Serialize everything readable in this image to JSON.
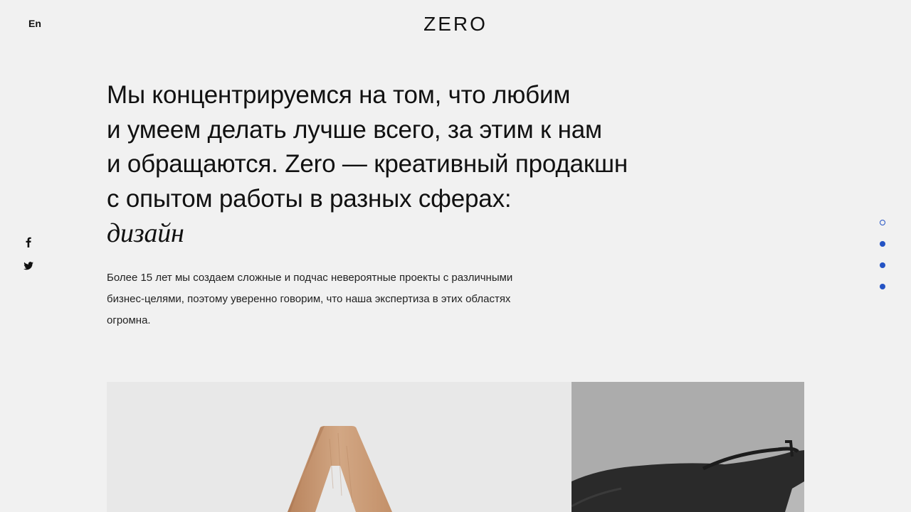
{
  "header": {
    "lang_switch": "En",
    "logo": "ZERO"
  },
  "social": {
    "items": [
      {
        "icon": "facebook-icon"
      },
      {
        "icon": "twitter-icon"
      }
    ]
  },
  "hero": {
    "lines": [
      "Мы концентрируемся на том, что любим",
      "и умеем делать лучше всего, за этим к нам",
      "и обращаются. Zero — креативный продакшн",
      "с опытом работы в разных сферах:"
    ],
    "accent_word": "дизайн"
  },
  "intro": {
    "text": "Более 15 лет мы создаем сложные и подчас невероятные проекты с различными бизнес-целями, поэтому уверенно говорим, что наша экспертиза в этих областях огромна."
  },
  "slide_nav": {
    "count": 4,
    "active_index": 0
  },
  "colors": {
    "background": "#f1f1f1",
    "text": "#111111",
    "accent": "#2453c4",
    "wood": "#c99a74"
  }
}
